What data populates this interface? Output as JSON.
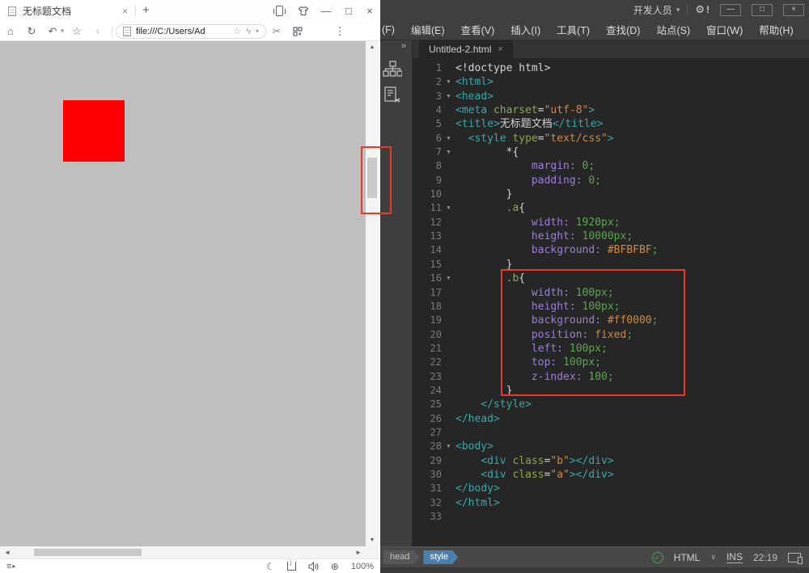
{
  "browser": {
    "tab": {
      "title": "无标题文档"
    },
    "address": {
      "value": "file:///C:/Users/Ad"
    },
    "status": {
      "zoom_level": "100%"
    },
    "page": {
      "background": "#BFBFBF",
      "square_color": "#FF0000"
    }
  },
  "editor": {
    "titlebar": {
      "workspace": "开发人员",
      "alert": "!"
    },
    "menubar": {
      "items": [
        "(F)",
        "编辑(E)",
        "查看(V)",
        "插入(I)",
        "工具(T)",
        "查找(D)",
        "站点(S)",
        "窗口(W)",
        "帮助(H)"
      ]
    },
    "sidebar": {
      "icons": [
        "files-tree",
        "code-snippets"
      ]
    },
    "tab": {
      "name": "Untitled-2.html"
    },
    "code": {
      "fold_glyph": "▼",
      "token_colors": {
        "w": "#D4D4D4",
        "tag": "#38A8A8",
        "attr": "#8CA84E",
        "str": "#CE8A48",
        "prop": "#9B80D6",
        "val": "#59A84D",
        "sel": "#8CA84E"
      },
      "lines": [
        {
          "n": 1,
          "t": [
            [
              "<!doctype html>",
              "w"
            ]
          ]
        },
        {
          "n": 2,
          "fold": true,
          "t": [
            [
              "<html>",
              "tag"
            ]
          ]
        },
        {
          "n": 3,
          "fold": true,
          "t": [
            [
              "<head>",
              "tag"
            ]
          ]
        },
        {
          "n": 4,
          "t": [
            [
              "<meta ",
              "tag"
            ],
            [
              "charset",
              "attr"
            ],
            [
              "=",
              "w"
            ],
            [
              "\"utf-8\"",
              "str"
            ],
            [
              ">",
              "tag"
            ]
          ]
        },
        {
          "n": 5,
          "t": [
            [
              "<title>",
              "tag"
            ],
            [
              "无标题文档",
              "w"
            ],
            [
              "</title>",
              "tag"
            ]
          ]
        },
        {
          "n": 6,
          "fold": true,
          "t": [
            [
              "  ",
              "w"
            ],
            [
              "<style ",
              "tag"
            ],
            [
              "type",
              "attr"
            ],
            [
              "=",
              "w"
            ],
            [
              "\"text/css\"",
              "str"
            ],
            [
              ">",
              "tag"
            ]
          ]
        },
        {
          "n": 7,
          "fold": true,
          "t": [
            [
              "        *{",
              "w"
            ]
          ]
        },
        {
          "n": 8,
          "t": [
            [
              "            ",
              "w"
            ],
            [
              "margin:",
              "prop"
            ],
            [
              " ",
              "w"
            ],
            [
              "0;",
              "val"
            ]
          ]
        },
        {
          "n": 9,
          "t": [
            [
              "            ",
              "w"
            ],
            [
              "padding:",
              "prop"
            ],
            [
              " ",
              "w"
            ],
            [
              "0;",
              "val"
            ]
          ]
        },
        {
          "n": 10,
          "t": [
            [
              "        }",
              "w"
            ]
          ]
        },
        {
          "n": 11,
          "fold": true,
          "t": [
            [
              "        ",
              "w"
            ],
            [
              ".a",
              "sel"
            ],
            [
              "{",
              "w"
            ]
          ]
        },
        {
          "n": 12,
          "t": [
            [
              "            ",
              "w"
            ],
            [
              "width:",
              "prop"
            ],
            [
              " ",
              "w"
            ],
            [
              "1920px;",
              "val"
            ]
          ]
        },
        {
          "n": 13,
          "t": [
            [
              "            ",
              "w"
            ],
            [
              "height:",
              "prop"
            ],
            [
              " ",
              "w"
            ],
            [
              "10000px;",
              "val"
            ]
          ]
        },
        {
          "n": 14,
          "t": [
            [
              "            ",
              "w"
            ],
            [
              "background:",
              "prop"
            ],
            [
              " ",
              "w"
            ],
            [
              "#BFBFBF",
              "str"
            ],
            [
              ";",
              "val"
            ]
          ]
        },
        {
          "n": 15,
          "t": [
            [
              "        }",
              "w"
            ]
          ]
        },
        {
          "n": 16,
          "fold": true,
          "t": [
            [
              "        ",
              "w"
            ],
            [
              ".b",
              "sel"
            ],
            [
              "{",
              "w"
            ]
          ]
        },
        {
          "n": 17,
          "t": [
            [
              "            ",
              "w"
            ],
            [
              "width:",
              "prop"
            ],
            [
              " ",
              "w"
            ],
            [
              "100px;",
              "val"
            ]
          ]
        },
        {
          "n": 18,
          "t": [
            [
              "            ",
              "w"
            ],
            [
              "height:",
              "prop"
            ],
            [
              " ",
              "w"
            ],
            [
              "100px;",
              "val"
            ]
          ]
        },
        {
          "n": 19,
          "t": [
            [
              "            ",
              "w"
            ],
            [
              "background:",
              "prop"
            ],
            [
              " ",
              "w"
            ],
            [
              "#ff0000",
              "str"
            ],
            [
              ";",
              "val"
            ]
          ]
        },
        {
          "n": 20,
          "t": [
            [
              "            ",
              "w"
            ],
            [
              "position:",
              "prop"
            ],
            [
              " ",
              "w"
            ],
            [
              "fixed",
              "str"
            ],
            [
              ";",
              "val"
            ]
          ]
        },
        {
          "n": 21,
          "t": [
            [
              "            ",
              "w"
            ],
            [
              "left:",
              "prop"
            ],
            [
              " ",
              "w"
            ],
            [
              "100px;",
              "val"
            ]
          ]
        },
        {
          "n": 22,
          "t": [
            [
              "            ",
              "w"
            ],
            [
              "top:",
              "prop"
            ],
            [
              " ",
              "w"
            ],
            [
              "100px;",
              "val"
            ]
          ]
        },
        {
          "n": 23,
          "t": [
            [
              "            ",
              "w"
            ],
            [
              "z-index:",
              "prop"
            ],
            [
              " ",
              "w"
            ],
            [
              "100;",
              "val"
            ]
          ]
        },
        {
          "n": 24,
          "t": [
            [
              "        }",
              "w"
            ]
          ]
        },
        {
          "n": 25,
          "t": [
            [
              "    </style>",
              "tag"
            ]
          ]
        },
        {
          "n": 26,
          "t": [
            [
              "</head>",
              "tag"
            ]
          ]
        },
        {
          "n": 27,
          "t": []
        },
        {
          "n": 28,
          "fold": true,
          "t": [
            [
              "<body>",
              "tag"
            ]
          ]
        },
        {
          "n": 29,
          "t": [
            [
              "    ",
              "w"
            ],
            [
              "<div ",
              "tag"
            ],
            [
              "class",
              "attr"
            ],
            [
              "=",
              "w"
            ],
            [
              "\"b\"",
              "str"
            ],
            [
              "></div>",
              "tag"
            ]
          ]
        },
        {
          "n": 30,
          "t": [
            [
              "    ",
              "w"
            ],
            [
              "<div ",
              "tag"
            ],
            [
              "class",
              "attr"
            ],
            [
              "=",
              "w"
            ],
            [
              "\"a\"",
              "str"
            ],
            [
              "></div>",
              "tag"
            ]
          ]
        },
        {
          "n": 31,
          "t": [
            [
              "</body>",
              "tag"
            ]
          ]
        },
        {
          "n": 32,
          "t": [
            [
              "</html>",
              "tag"
            ]
          ]
        },
        {
          "n": 33,
          "t": []
        }
      ]
    },
    "statusbar": {
      "breadcrumb": [
        {
          "label": "head",
          "active": false
        },
        {
          "label": "style",
          "active": true
        }
      ],
      "doc_type": "HTML",
      "mode": "INS",
      "time": "22:19"
    }
  },
  "icons": {
    "home": "⌂",
    "refresh": "↻",
    "undo": "↶",
    "caret": "▾",
    "star": "☆",
    "back": "‹",
    "flash": "ϟ",
    "scissors": "✂",
    "more": "⋮",
    "minimize": "—",
    "maximize": "□",
    "close": "×",
    "newtab": "+",
    "up": "▲",
    "down": "▼",
    "left": "◄",
    "right": "►",
    "moon": "☾",
    "zoom_plus": "⊕",
    "chevrons": "»",
    "gear": "⚙",
    "check": "✓",
    "menu": "≡",
    "play": "▸",
    "chevdown": "∨",
    "dl_arrow": "↓"
  },
  "annotations": {
    "color": "#E8392C"
  }
}
